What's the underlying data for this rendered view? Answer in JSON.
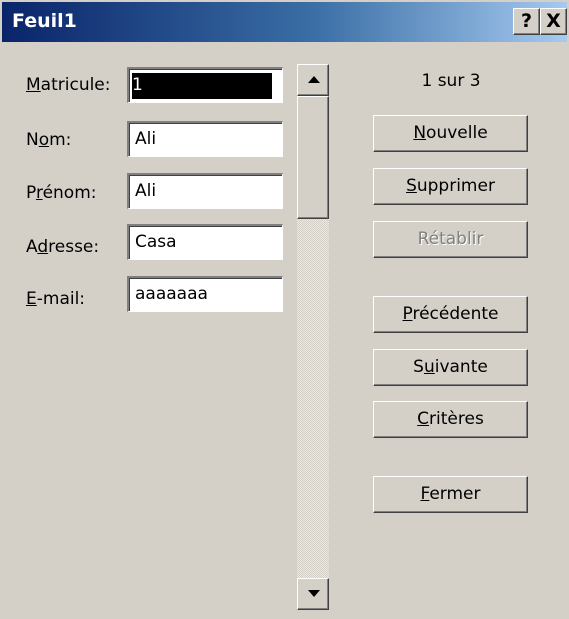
{
  "window": {
    "title": "Feuil1",
    "help_glyph": "?",
    "close_glyph": "X"
  },
  "record_counter": "1 sur 3",
  "fields": [
    {
      "label_pre": "",
      "label_ul": "M",
      "label_post": "atricule:",
      "value": "1",
      "selected": true
    },
    {
      "label_pre": "N",
      "label_ul": "o",
      "label_post": "m:",
      "value": "Ali",
      "selected": false
    },
    {
      "label_pre": "P",
      "label_ul": "r",
      "label_post": "énom:",
      "value": "Ali",
      "selected": false
    },
    {
      "label_pre": "A",
      "label_ul": "d",
      "label_post": "resse:",
      "value": "Casa",
      "selected": false
    },
    {
      "label_pre": "",
      "label_ul": "E",
      "label_post": "-mail:",
      "value": "aaaaaaa",
      "selected": false
    }
  ],
  "buttons": {
    "nouvelle": {
      "pre": "",
      "ul": "N",
      "post": "ouvelle"
    },
    "supprimer": {
      "pre": "",
      "ul": "S",
      "post": "upprimer"
    },
    "retablir": {
      "pre": "",
      "ul": "",
      "post": "Rétablir",
      "disabled": true
    },
    "precedente": {
      "pre": "",
      "ul": "P",
      "post": "récédente"
    },
    "suivante": {
      "pre": "S",
      "ul": "u",
      "post": "ivante"
    },
    "criteres": {
      "pre": "",
      "ul": "C",
      "post": "ritères"
    },
    "fermer": {
      "pre": "",
      "ul": "F",
      "post": "ermer"
    }
  },
  "icons": {
    "help": "question-mark-icon",
    "close": "close-icon",
    "scroll_up": "arrow-up-icon",
    "scroll_down": "arrow-down-icon"
  }
}
